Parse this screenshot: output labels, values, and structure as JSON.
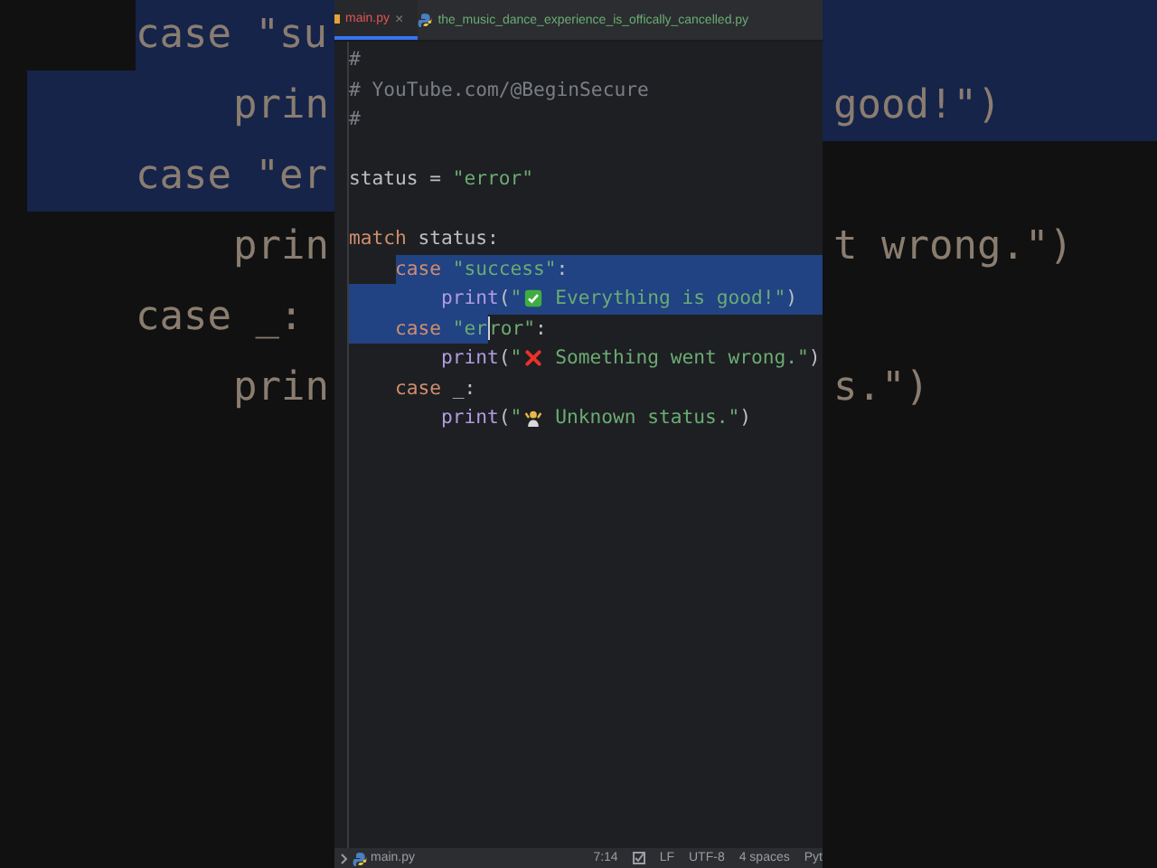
{
  "background": {
    "rows": [
      {
        "left": "case \"su",
        "indent_selected": false,
        "left_selected": true,
        "right_selected": true,
        "children": [
          {
            "left": "prin",
            "right": "good!\")",
            "indent_selected": true,
            "left_selected": true,
            "right_selected": true
          }
        ]
      },
      {
        "left": "case \"er",
        "indent_selected": true,
        "left_selected": true,
        "right_selected": false,
        "children": [
          {
            "left": "prin",
            "right": "t wrong.\")",
            "indent_selected": false,
            "left_selected": false,
            "right_selected": false
          }
        ]
      },
      {
        "left": "case _:",
        "indent_selected": false,
        "left_selected": false,
        "right_selected": false,
        "children": [
          {
            "left": "prin",
            "right": "s.\")",
            "indent_selected": false,
            "left_selected": false,
            "right_selected": false
          }
        ]
      }
    ]
  },
  "tabs": [
    {
      "label": "main.py",
      "close": "×",
      "selected": true,
      "kind": "error"
    },
    {
      "label": "the_music_dance_experience_is_offically_cancelled.py",
      "selected": false,
      "kind": "python"
    }
  ],
  "editor": {
    "lines": [
      {
        "kind": "code",
        "tokens": [
          {
            "kind": "comment",
            "text": "#"
          }
        ]
      },
      {
        "kind": "code",
        "tokens": [
          {
            "kind": "comment",
            "text": "# YouTube.com/@BeginSecure"
          }
        ]
      },
      {
        "kind": "code",
        "tokens": [
          {
            "kind": "comment",
            "text": "#"
          }
        ]
      },
      {
        "kind": "blank"
      },
      {
        "kind": "code",
        "tokens": [
          {
            "kind": "ident",
            "text": "status = "
          },
          {
            "kind": "string",
            "text": "\"error\""
          }
        ]
      },
      {
        "kind": "blank"
      },
      {
        "kind": "code",
        "tokens": [
          {
            "kind": "keyword",
            "text": "match"
          },
          {
            "kind": "ident",
            "text": " status:"
          }
        ],
        "children": [
          {
            "kind": "code",
            "indent_selected": false,
            "text_selected": true,
            "tail_selected": true,
            "tokens": [
              {
                "kind": "keyword",
                "text": "case"
              },
              {
                "kind": "string",
                "text": " \"success\""
              },
              {
                "kind": "ident",
                "text": ":"
              }
            ],
            "children": [
              {
                "kind": "code",
                "indent_selected": true,
                "text_selected": true,
                "tail_selected": true,
                "tokens": [
                  {
                    "kind": "func",
                    "text": "print"
                  },
                  {
                    "kind": "ident",
                    "text": "("
                  },
                  {
                    "kind": "string",
                    "text": "\""
                  },
                  {
                    "kind": "check"
                  },
                  {
                    "kind": "string",
                    "text": " Everything is good!\""
                  },
                  {
                    "kind": "ident",
                    "text": ")"
                  }
                ]
              }
            ]
          },
          {
            "kind": "code",
            "indent_selected": true,
            "text_selected": true,
            "tail_selected": false,
            "tokens": [
              {
                "kind": "keyword",
                "text": "case",
                "cursor": false
              },
              {
                "kind": "string",
                "text": " \"er",
                "cursor": false
              },
              {
                "kind": "string",
                "text": "ror\"",
                "cursor": true
              },
              {
                "kind": "ident",
                "text": ":",
                "cursor": false
              }
            ],
            "children": [
              {
                "kind": "code",
                "tokens": [
                  {
                    "kind": "func",
                    "text": "print"
                  },
                  {
                    "kind": "ident",
                    "text": "("
                  },
                  {
                    "kind": "string",
                    "text": "\""
                  },
                  {
                    "kind": "cross"
                  },
                  {
                    "kind": "string",
                    "text": " Something went wrong.\""
                  },
                  {
                    "kind": "ident",
                    "text": ")"
                  }
                ]
              }
            ]
          },
          {
            "kind": "code",
            "tokens": [
              {
                "kind": "keyword",
                "text": "case"
              },
              {
                "kind": "ident",
                "text": " _:"
              }
            ],
            "children": [
              {
                "kind": "code",
                "tokens": [
                  {
                    "kind": "func",
                    "text": "print"
                  },
                  {
                    "kind": "ident",
                    "text": "("
                  },
                  {
                    "kind": "string",
                    "text": "\""
                  },
                  {
                    "kind": "shrug"
                  },
                  {
                    "kind": "string",
                    "text": " Unknown status.\""
                  },
                  {
                    "kind": "ident",
                    "text": ")"
                  }
                ]
              }
            ]
          }
        ]
      }
    ]
  },
  "status_bar": {
    "file": "main.py",
    "position": "7:14",
    "line_ending": "LF",
    "encoding": "UTF-8",
    "indent": "4 spaces",
    "language": "Pyt"
  }
}
